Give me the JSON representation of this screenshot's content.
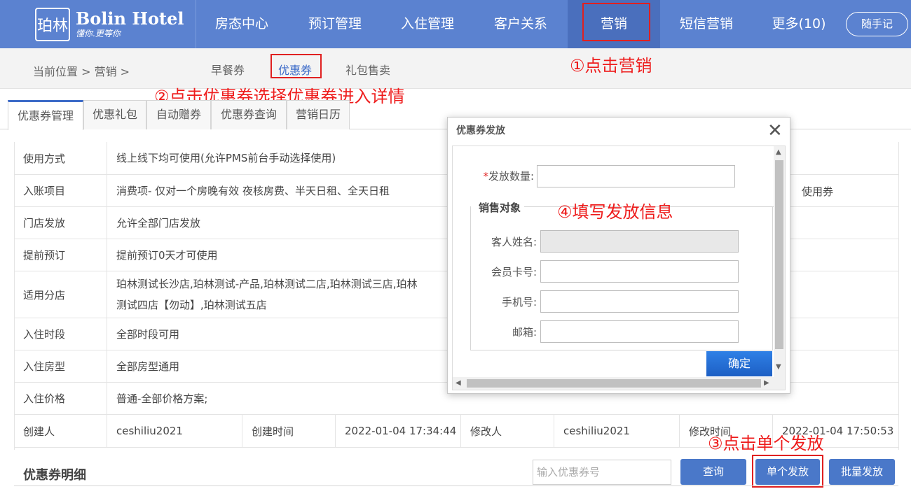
{
  "header": {
    "logo_mark": "珀林",
    "brand": "Bolin Hotel",
    "slogan": "懂你.更等你",
    "nav": [
      "房态中心",
      "预订管理",
      "入住管理",
      "客户关系",
      "营销",
      "短信营销",
      "更多(10)"
    ],
    "notes_button": "随手记"
  },
  "subnav": {
    "breadcrumb": "当前位置 > 营销 >",
    "items": [
      "早餐券",
      "优惠券",
      "礼包售卖"
    ]
  },
  "tabs": [
    "优惠券管理",
    "优惠礼包",
    "自动赠券",
    "优惠券查询",
    "营销日历"
  ],
  "details": [
    {
      "label": "使用方式",
      "value": "线上线下均可使用(允许PMS前台手动选择使用)"
    },
    {
      "label": "入账项目",
      "value": "消费项- 仅对一个房晚有效 夜核房费、半天日租、全天日租",
      "right": "使用券"
    },
    {
      "label": "门店发放",
      "value": "允许全部门店发放"
    },
    {
      "label": "提前预订",
      "value": "提前预订0天才可使用"
    },
    {
      "label": "适用分店",
      "value_line1": "珀林测试长沙店,珀林测试-产品,珀林测试二店,珀林测试三店,珀林",
      "value_line2": "测试四店【勿动】,珀林测试五店"
    },
    {
      "label": "入住时段",
      "value": "全部时段可用"
    },
    {
      "label": "入住房型",
      "value": "全部房型通用"
    },
    {
      "label": "入住价格",
      "value": "普通-全部价格方案;"
    }
  ],
  "creator_row": {
    "creator_label": "创建人",
    "creator": "ceshiliu2021",
    "created_label": "创建时间",
    "created": "2022-01-04 17:34:44",
    "modifier_label": "修改人",
    "modifier": "ceshiliu2021",
    "modified_label": "修改时间",
    "modified": "2022-01-04 17:50:53"
  },
  "coupon_details": {
    "title": "优惠券明细",
    "search_placeholder": "输入优惠券号",
    "query_button": "查询",
    "single_issue_button": "单个发放",
    "batch_issue_button": "批量发放"
  },
  "modal": {
    "title": "优惠券发放",
    "required_mark": "*",
    "quantity_label": "发放数量:",
    "sales_target_legend": "销售对象",
    "guest_name_label": "客人姓名:",
    "member_card_label": "会员卡号:",
    "phone_label": "手机号:",
    "email_label": "邮箱:",
    "confirm_button": "确定"
  },
  "annotations": {
    "step1": "①点击营销",
    "step2": "②点击优惠券选择优惠券进入详情",
    "step3": "③点击单个发放",
    "step4": "④填写发放信息"
  },
  "colors": {
    "header_bg": "#5b82d0",
    "accent": "#3c6bc8",
    "annotation_red": "#e02020"
  }
}
